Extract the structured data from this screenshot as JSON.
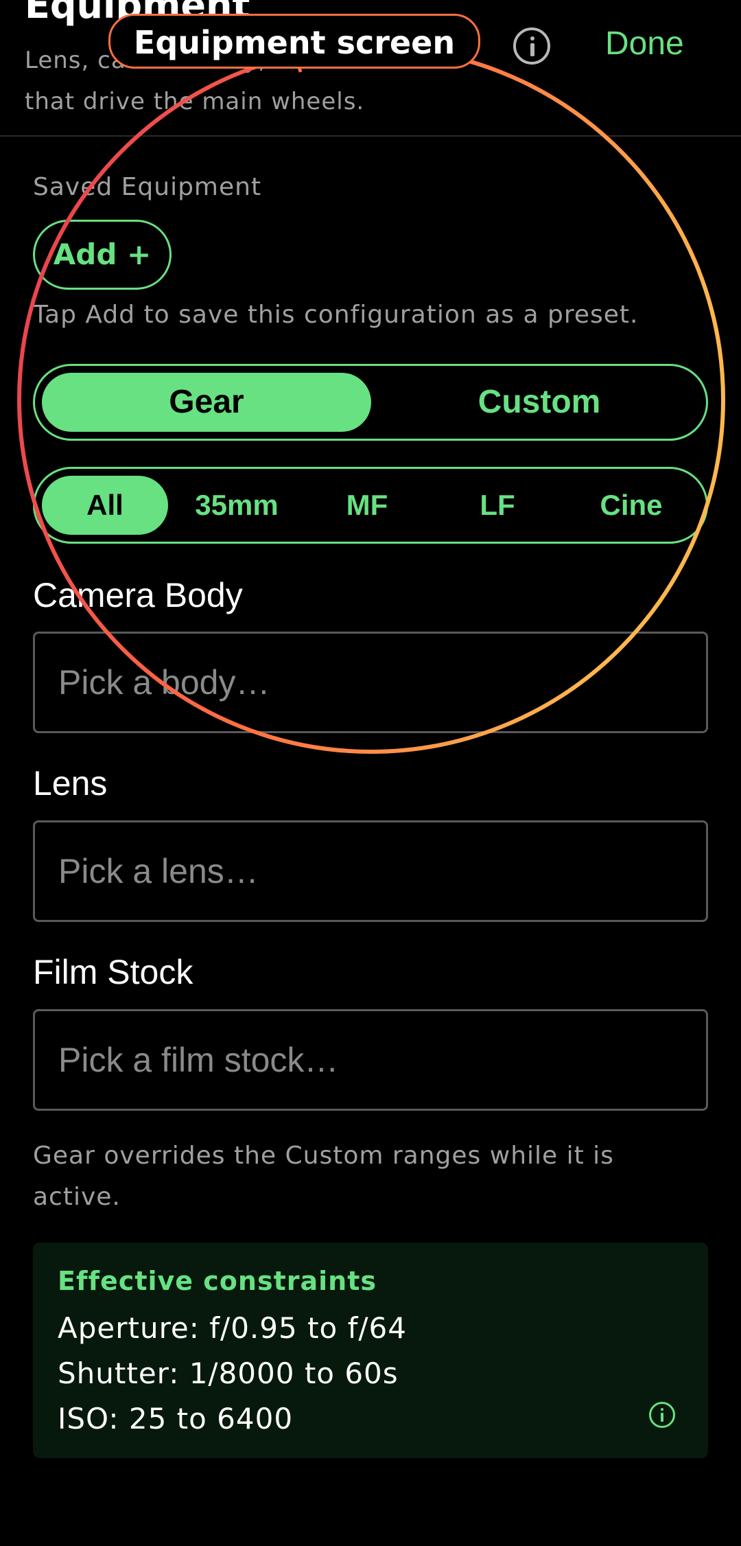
{
  "header": {
    "title": "Equipment",
    "subtitle": "Lens, camera body, and film stock that drive the main wheels.",
    "done_label": "Done",
    "info_icon": "info-icon"
  },
  "annotation": {
    "label": "Equipment screen",
    "colors": [
      "#ff7043",
      "#e53950",
      "#ffb74d"
    ]
  },
  "saved_equipment": {
    "label": "Saved Equipment",
    "add_label": "Add +",
    "hint": "Tap Add to save this configuration as a preset."
  },
  "mode_toggle": {
    "options": [
      "Gear",
      "Custom"
    ],
    "selected": "Gear"
  },
  "format_filter": {
    "options": [
      "All",
      "35mm",
      "MF",
      "LF",
      "Cine"
    ],
    "selected": "All"
  },
  "fields": {
    "camera_body": {
      "label": "Camera Body",
      "placeholder": "Pick a body…"
    },
    "lens": {
      "label": "Lens",
      "placeholder": "Pick a lens…"
    },
    "film_stock": {
      "label": "Film Stock",
      "placeholder": "Pick a film stock…"
    }
  },
  "note": "Gear overrides the Custom ranges while it is active.",
  "constraints": {
    "title": "Effective constraints",
    "aperture": "Aperture: f/0.95 to f/64",
    "shutter": "Shutter: 1/8000 to 60s",
    "iso": "ISO: 25 to 6400",
    "info_icon": "info-icon"
  },
  "colors": {
    "accent": "#67e182",
    "background": "#000000",
    "muted_text": "#a0a0a0",
    "card_bg": "#07190c"
  }
}
